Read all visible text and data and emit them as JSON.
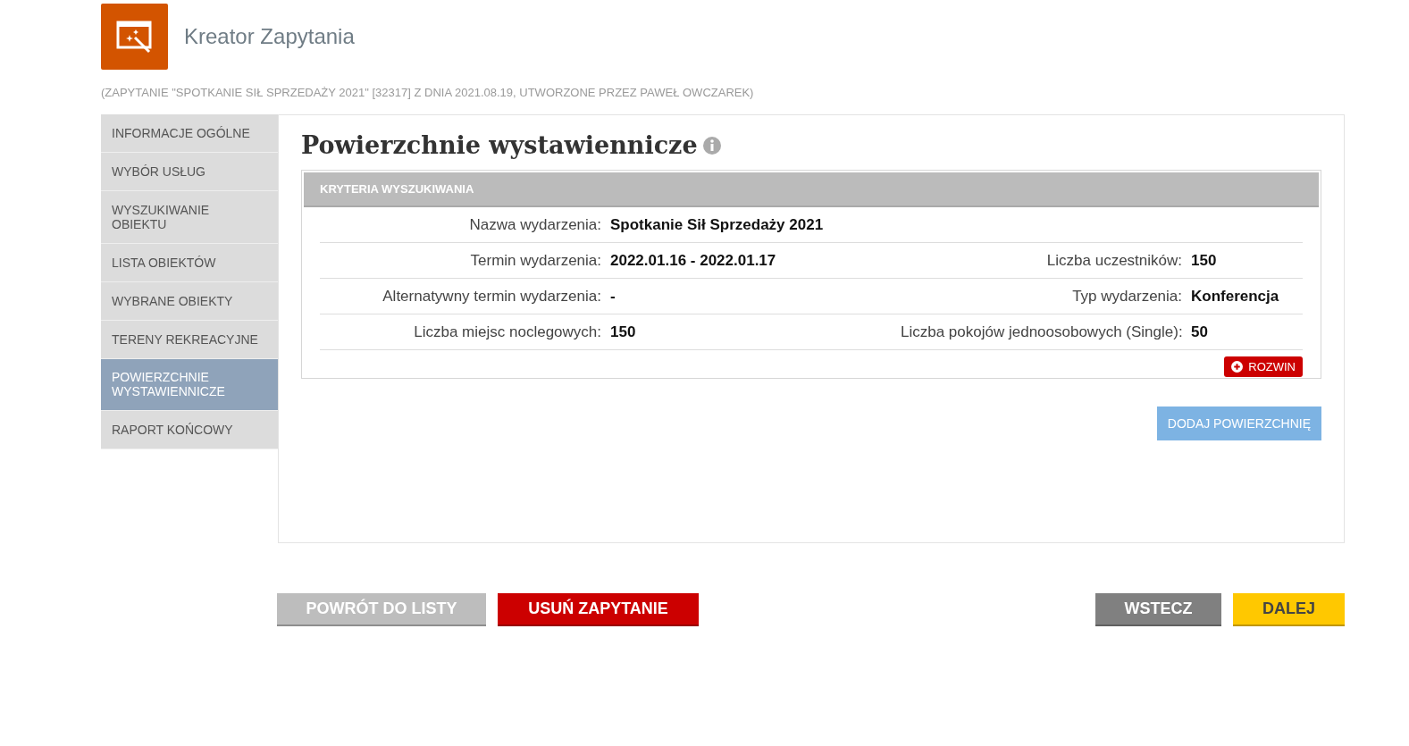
{
  "header": {
    "title": "Kreator Zapytania",
    "subtitle": "(ZAPYTANIE \"SPOTKANIE SIŁ SPRZEDAŻY 2021\" [32317] Z DNIA 2021.08.19, UTWORZONE PRZEZ PAWEŁ OWCZAREK)"
  },
  "sidebar": {
    "items": [
      {
        "label": "INFORMACJE OGÓLNE",
        "selected": false
      },
      {
        "label": "WYBÓR USŁUG",
        "selected": false
      },
      {
        "label": "WYSZUKIWANIE OBIEKTU",
        "selected": false
      },
      {
        "label": "LISTA OBIEKTÓW",
        "selected": false
      },
      {
        "label": "WYBRANE OBIEKTY",
        "selected": false
      },
      {
        "label": "TERENY REKREACYJNE",
        "selected": false
      },
      {
        "label": "POWIERZCHNIE WYSTAWIENNICZE",
        "selected": true
      },
      {
        "label": "RAPORT KOŃCOWY",
        "selected": false
      }
    ]
  },
  "content": {
    "title": "Powierzchnie wystawiennicze",
    "criteria": {
      "header": "KRYTERIA WYSZUKIWANIA",
      "rows": [
        {
          "left": {
            "label": "Nazwa wydarzenia:",
            "value": "Spotkanie Sił Sprzedaży 2021"
          }
        },
        {
          "left": {
            "label": "Termin wydarzenia:",
            "value": "2022.01.16 - 2022.01.17"
          },
          "right": {
            "label": "Liczba uczestników:",
            "value": "150"
          }
        },
        {
          "left": {
            "label": "Alternatywny termin wydarzenia:",
            "value": "-"
          },
          "right": {
            "label": "Typ wydarzenia:",
            "value": "Konferencja"
          }
        },
        {
          "left": {
            "label": "Liczba miejsc noclegowych:",
            "value": "150"
          },
          "right": {
            "label": "Liczba pokojów jednoosobowych (Single):",
            "value": "50"
          }
        }
      ],
      "expand_button": "ROZWIN"
    },
    "add_button": "DODAJ POWIERZCHNIĘ"
  },
  "footer": {
    "buttons": [
      {
        "label": "POWRÓT DO LISTY",
        "kind": "secondary"
      },
      {
        "label": "USUŃ ZAPYTANIE",
        "kind": "danger"
      },
      {
        "label": "WSTECZ",
        "kind": "back"
      },
      {
        "label": "DALEJ",
        "kind": "next"
      }
    ]
  }
}
